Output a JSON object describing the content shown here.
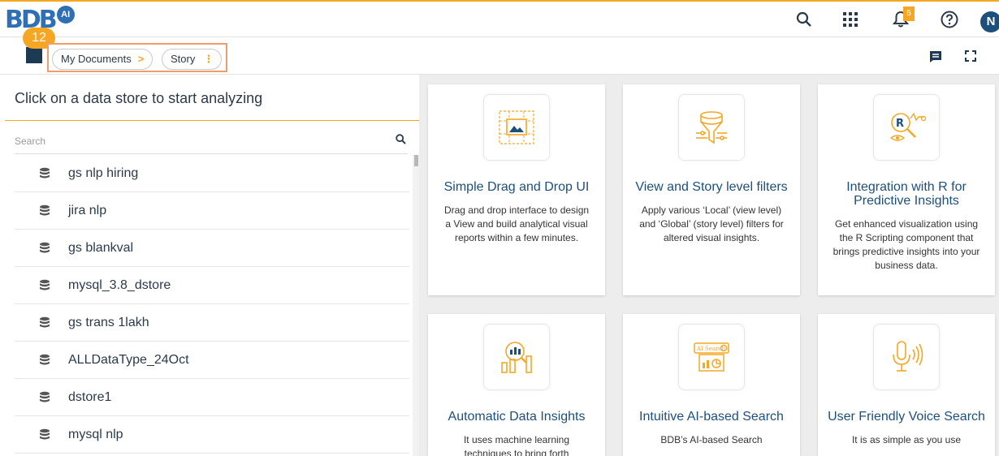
{
  "header": {
    "logo_text": "BDB",
    "logo_badge": "AI",
    "notification_count": "5",
    "avatar_initial": "N"
  },
  "guide": {
    "step_number": "12"
  },
  "breadcrumb": {
    "items": [
      "My Documents",
      "Story"
    ]
  },
  "left_panel": {
    "title": "Click on a data store to start analyzing",
    "search_placeholder": "Search",
    "datastores": [
      "gs nlp hiring",
      "jira nlp",
      "gs blankval",
      "mysql_3.8_dstore",
      "gs trans 1lakh",
      "ALLDataType_24Oct",
      "dstore1",
      "mysql nlp"
    ]
  },
  "features": [
    {
      "title": "Simple Drag and Drop UI",
      "desc": "Drag and drop interface to design a View and build analytical visual reports within a few minutes.",
      "icon": "drag-drop-icon"
    },
    {
      "title": "View and Story level filters",
      "desc": "Apply various ‘Local’ (view level) and ‘Global’ (story level) filters for altered visual insights.",
      "icon": "filter-icon"
    },
    {
      "title": "Integration with R for Predictive Insights",
      "desc": "Get enhanced visualization using the R Scripting component that brings predictive insights into your business data.",
      "icon": "r-integration-icon"
    },
    {
      "title": "Automatic Data Insights",
      "desc": "It uses machine learning techniques to bring forth",
      "icon": "data-insights-icon"
    },
    {
      "title": "Intuitive AI-based Search",
      "desc": "BDB’s AI-based Search",
      "icon": "ai-search-icon"
    },
    {
      "title": "User Friendly Voice Search",
      "desc": "It is as simple as you use",
      "icon": "voice-search-icon"
    }
  ],
  "colors": {
    "accent": "#f5a623",
    "brand": "#1d4f7c",
    "text": "#2b3a4a"
  }
}
